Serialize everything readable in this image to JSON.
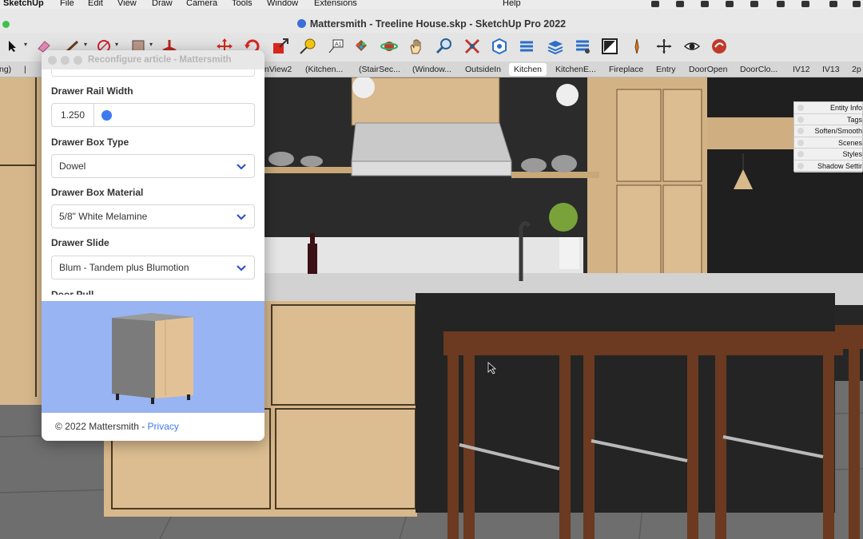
{
  "menubar": {
    "app": "SketchUp",
    "items": [
      "File",
      "Edit",
      "View",
      "Draw",
      "Camera",
      "Tools",
      "Window",
      "Extensions"
    ],
    "help": "Help"
  },
  "window": {
    "title": "Mattersmith - Treeline House.skp - SketchUp Pro 2022"
  },
  "toolbar": {
    "tools": [
      "select-icon",
      "eraser-icon",
      "pencil-icon",
      "circle-icon",
      "rectangle-icon",
      "push-pull-icon",
      "move-icon",
      "rotate-icon",
      "scale-icon",
      "tape-measure-icon",
      "text-label-icon",
      "paint-bucket-icon",
      "orbit-icon",
      "pan-icon",
      "zoom-icon",
      "zoom-extents-icon",
      "warehouse-icon",
      "extension-icon",
      "layers-icon",
      "stack-icon",
      "style-icon",
      "section-icon",
      "axes-icon",
      "eye-icon",
      "ruby-icon"
    ]
  },
  "scene_tabs": {
    "tabs": [
      "ng)",
      "|",
      "nView2",
      "(Kitchen...",
      "(StairSec...",
      "(Window...",
      "OutsideIn",
      "Kitchen",
      "KitchenE...",
      "Fireplace",
      "Entry",
      "DoorOpen",
      "DoorClo...",
      "IV12",
      "IV13",
      "2p"
    ],
    "active": "Kitchen"
  },
  "tray": {
    "panels": [
      "Entity Info",
      "Tags",
      "Soften/Smooth",
      "Scenes",
      "Styles",
      "Shadow Settings"
    ]
  },
  "dialog": {
    "title": "Reconfigure article - Mattersmith",
    "fields": {
      "rail_width_label": "Drawer Rail Width",
      "rail_width_value": "1.250",
      "rail_width_slider": 0.0,
      "box_type_label": "Drawer Box Type",
      "box_type_value": "Dowel",
      "box_material_label": "Drawer Box Material",
      "box_material_value": "5/8\" White Melamine",
      "slide_label": "Drawer Slide",
      "slide_value": "Blum - Tandem plus Blumotion",
      "next_label": "Door Pull"
    },
    "footer": {
      "copyright": "© 2022 Mattersmith - ",
      "privacy": "Privacy"
    }
  },
  "colors": {
    "accent": "#3d79f0",
    "preview_bg": "#98b4f2",
    "oak": "#d9b98e",
    "wall": "#2b2b2b"
  }
}
